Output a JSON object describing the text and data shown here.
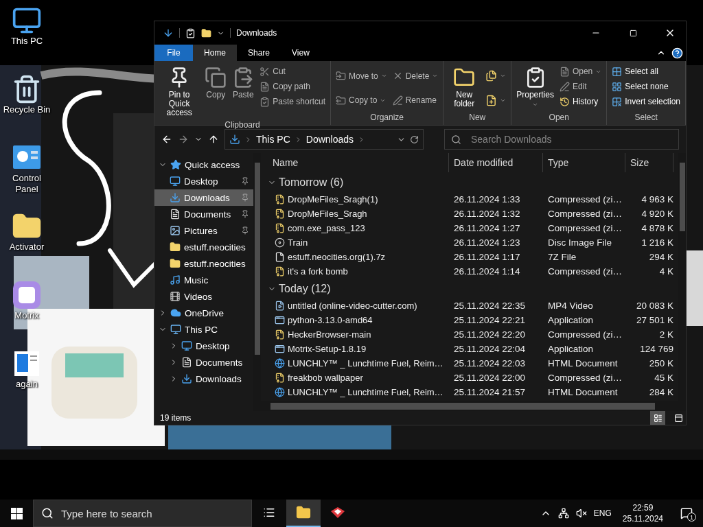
{
  "desktop_icons": [
    {
      "label": "This PC",
      "kind": "pc"
    },
    {
      "label": "Recycle Bin",
      "kind": "bin"
    },
    {
      "label": "Control Panel",
      "kind": "panel"
    },
    {
      "label": "Activator",
      "kind": "folder"
    },
    {
      "label": "Motrix",
      "kind": "motrix"
    },
    {
      "label": "again",
      "kind": "doc"
    }
  ],
  "explorer": {
    "title": "Downloads",
    "tabs": [
      {
        "label": "File",
        "kind": "file",
        "selected": false
      },
      {
        "label": "Home",
        "kind": "tab",
        "selected": true
      },
      {
        "label": "Share",
        "kind": "tab",
        "selected": false
      },
      {
        "label": "View",
        "kind": "tab",
        "selected": false
      }
    ],
    "ribbon": [
      {
        "label": "Clipboard",
        "columns": [
          [
            {
              "label": "Pin to Quick access",
              "kind": "large",
              "disabled": false,
              "dropdown": false
            }
          ],
          [
            {
              "label": "Copy",
              "kind": "large",
              "disabled": true,
              "dropdown": false
            }
          ],
          [
            {
              "label": "Paste",
              "kind": "large",
              "disabled": true,
              "dropdown": false
            }
          ],
          [
            {
              "label": "Cut",
              "kind": "small",
              "disabled": true,
              "dropdown": false
            },
            {
              "label": "Copy path",
              "kind": "small",
              "disabled": true,
              "dropdown": false
            },
            {
              "label": "Paste shortcut",
              "kind": "small",
              "disabled": true,
              "dropdown": false
            }
          ]
        ]
      },
      {
        "label": "Organize",
        "columns": [
          [
            {
              "label": "Move to",
              "kind": "small",
              "disabled": true,
              "dropdown": true
            },
            {
              "label": "Copy to",
              "kind": "small",
              "disabled": true,
              "dropdown": true
            }
          ],
          [
            {
              "label": "Delete",
              "kind": "small",
              "disabled": true,
              "dropdown": true
            },
            {
              "label": "Rename",
              "kind": "small",
              "disabled": true,
              "dropdown": false
            }
          ]
        ]
      },
      {
        "label": "New",
        "columns": [
          [
            {
              "label": "New folder",
              "kind": "large",
              "disabled": false,
              "dropdown": false
            }
          ],
          [
            {
              "kind": "icon",
              "disabled": false,
              "dropdown": true
            },
            {
              "kind": "icon",
              "disabled": false,
              "dropdown": true
            }
          ]
        ]
      },
      {
        "label": "Open",
        "columns": [
          [
            {
              "label": "Properties",
              "kind": "large",
              "disabled": false,
              "dropdown": true
            }
          ],
          [
            {
              "label": "Open",
              "kind": "small",
              "disabled": true,
              "dropdown": true
            },
            {
              "label": "Edit",
              "kind": "small",
              "disabled": true,
              "dropdown": false
            },
            {
              "label": "History",
              "kind": "small",
              "disabled": false,
              "dropdown": false
            }
          ]
        ]
      },
      {
        "label": "Select",
        "columns": [
          [
            {
              "label": "Select all",
              "kind": "small",
              "disabled": false,
              "dropdown": false
            },
            {
              "label": "Select none",
              "kind": "small",
              "disabled": false,
              "dropdown": false
            },
            {
              "label": "Invert selection",
              "kind": "small",
              "disabled": false,
              "dropdown": false
            }
          ]
        ]
      }
    ],
    "address": {
      "crumbs": [
        "This PC",
        "Downloads"
      ]
    },
    "search": {
      "placeholder": "Search Downloads"
    },
    "nav": [
      {
        "label": "Quick access",
        "kind": "quick",
        "expanded": true,
        "selected": false,
        "children": [
          {
            "label": "Desktop",
            "kind": "desktop",
            "pinned": true,
            "selected": false
          },
          {
            "label": "Downloads",
            "kind": "downloads",
            "pinned": true,
            "selected": true
          },
          {
            "label": "Documents",
            "kind": "documents",
            "pinned": true,
            "selected": false
          },
          {
            "label": "Pictures",
            "kind": "pictures",
            "pinned": true,
            "selected": false
          },
          {
            "label": "estuff.neocities",
            "kind": "folder",
            "pinned": false,
            "selected": false
          },
          {
            "label": "estuff.neocities",
            "kind": "folder",
            "pinned": false,
            "selected": false
          },
          {
            "label": "Music",
            "kind": "music",
            "pinned": false,
            "selected": false
          },
          {
            "label": "Videos",
            "kind": "videos",
            "pinned": false,
            "selected": false
          }
        ]
      },
      {
        "label": "OneDrive",
        "kind": "onedrive",
        "expanded": false,
        "selected": false
      },
      {
        "label": "This PC",
        "kind": "pc",
        "expanded": true,
        "selected": false,
        "children": [
          {
            "label": "Desktop",
            "kind": "desktop",
            "expanded": false,
            "selected": false
          },
          {
            "label": "Documents",
            "kind": "documents",
            "expanded": false,
            "selected": false
          },
          {
            "label": "Downloads",
            "kind": "downloads",
            "expanded": false,
            "selected": false
          }
        ]
      }
    ],
    "columns": [
      "Name",
      "Date modified",
      "Type",
      "Size"
    ],
    "groups": [
      {
        "label": "Tomorrow (6)",
        "expanded": true,
        "rows": [
          {
            "name": "DropMeFiles_Sragh(1)",
            "date": "26.11.2024 1:33",
            "type": "Compressed (zi…",
            "size": "4 963 K",
            "kind": "zip"
          },
          {
            "name": "DropMeFiles_Sragh",
            "date": "26.11.2024 1:32",
            "type": "Compressed (zi…",
            "size": "4 920 K",
            "kind": "zip"
          },
          {
            "name": "com.exe_pass_123",
            "date": "26.11.2024 1:27",
            "type": "Compressed (zi…",
            "size": "4 878 K",
            "kind": "zip"
          },
          {
            "name": "Train",
            "date": "26.11.2024 1:23",
            "type": "Disc Image File",
            "size": "1 216 K",
            "kind": "disc"
          },
          {
            "name": "estuff.neocities.org(1).7z",
            "date": "26.11.2024 1:17",
            "type": "7Z File",
            "size": "294 K",
            "kind": "file"
          },
          {
            "name": "it's a fork bomb",
            "date": "26.11.2024 1:14",
            "type": "Compressed (zi…",
            "size": "4 K",
            "kind": "zip"
          }
        ]
      },
      {
        "label": "Today (12)",
        "expanded": true,
        "rows": [
          {
            "name": "untitled (online-video-cutter.com)",
            "date": "25.11.2024 22:35",
            "type": "MP4 Video",
            "size": "20 083 K",
            "kind": "video"
          },
          {
            "name": "python-3.13.0-amd64",
            "date": "25.11.2024 22:21",
            "type": "Application",
            "size": "27 501 K",
            "kind": "app"
          },
          {
            "name": "HeckerBrowser-main",
            "date": "25.11.2024 22:20",
            "type": "Compressed (zi…",
            "size": "2 K",
            "kind": "zip"
          },
          {
            "name": "Motrix-Setup-1.8.19",
            "date": "25.11.2024 22:04",
            "type": "Application",
            "size": "124 769",
            "kind": "app"
          },
          {
            "name": "LUNCHLY™ _ Lunchtime Fuel, Reim…",
            "date": "25.11.2024 22:03",
            "type": "HTML Document",
            "size": "250 K",
            "kind": "html"
          },
          {
            "name": "freakbob wallpaper",
            "date": "25.11.2024 22:00",
            "type": "Compressed (zi…",
            "size": "45 K",
            "kind": "zip"
          },
          {
            "name": "LUNCHLY™ _ Lunchtime Fuel, Reim…",
            "date": "25.11.2024 21:57",
            "type": "HTML Document",
            "size": "284 K",
            "kind": "html"
          }
        ]
      }
    ],
    "status": "19 items",
    "views": [
      {
        "kind": "details",
        "selected": true
      },
      {
        "kind": "icons",
        "selected": false
      }
    ]
  },
  "taskbar": {
    "search_placeholder": "Type here to search",
    "apps": [
      {
        "kind": "explorer",
        "selected": true
      },
      {
        "kind": "red",
        "selected": false
      }
    ],
    "language": "ENG",
    "time": "22:59",
    "date": "25.11.2024",
    "notification_count": "1"
  }
}
